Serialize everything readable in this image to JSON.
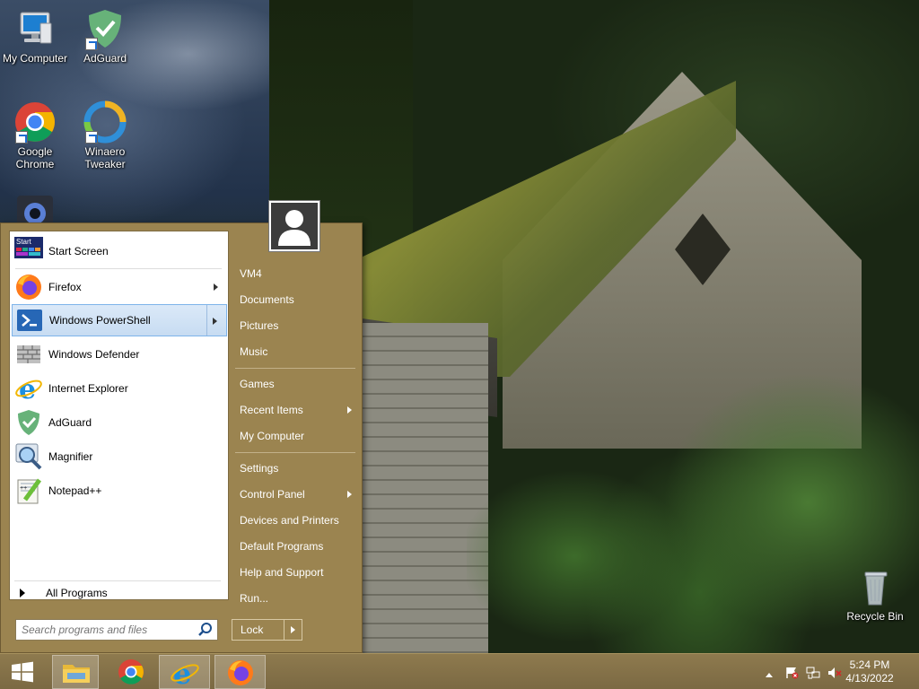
{
  "desktop": {
    "icons": [
      {
        "label": "My Computer"
      },
      {
        "label": "AdGuard"
      },
      {
        "label": "Google Chrome"
      },
      {
        "label": "Winaero Tweaker"
      },
      {
        "label": "Recycle Bin"
      }
    ]
  },
  "start_menu": {
    "pinned": [
      {
        "label": "Start Screen",
        "icon": "start-screen-icon"
      },
      {
        "label": "Firefox",
        "icon": "firefox-icon",
        "submenu": true
      },
      {
        "label": "Windows PowerShell",
        "icon": "powershell-icon",
        "submenu": true,
        "selected": true
      },
      {
        "label": "Windows Defender",
        "icon": "defender-icon"
      },
      {
        "label": "Internet Explorer",
        "icon": "ie-icon"
      },
      {
        "label": "AdGuard",
        "icon": "adguard-icon"
      },
      {
        "label": "Magnifier",
        "icon": "magnifier-icon"
      },
      {
        "label": "Notepad++",
        "icon": "notepadpp-icon"
      }
    ],
    "start_icon_text": "Start",
    "all_programs": "All Programs",
    "search_placeholder": "Search programs and files",
    "right_pane": [
      {
        "label": "VM4"
      },
      {
        "label": "Documents"
      },
      {
        "label": "Pictures"
      },
      {
        "label": "Music"
      },
      {
        "label": "Games"
      },
      {
        "label": "Recent Items",
        "submenu": true
      },
      {
        "label": "My Computer"
      },
      {
        "label": "Settings"
      },
      {
        "label": "Control Panel",
        "submenu": true
      },
      {
        "label": "Devices and Printers"
      },
      {
        "label": "Default Programs"
      },
      {
        "label": "Help and Support"
      },
      {
        "label": "Run..."
      }
    ],
    "lock_label": "Lock"
  },
  "taskbar": {
    "apps": [
      "File Explorer",
      "Google Chrome",
      "Internet Explorer",
      "Firefox"
    ],
    "clock_time": "5:24 PM",
    "clock_date": "4/13/2022"
  },
  "colors": {
    "start_menu_bg": "#9b8450",
    "taskbar_bg": "#84714a",
    "selection": "#c7dcf2"
  }
}
